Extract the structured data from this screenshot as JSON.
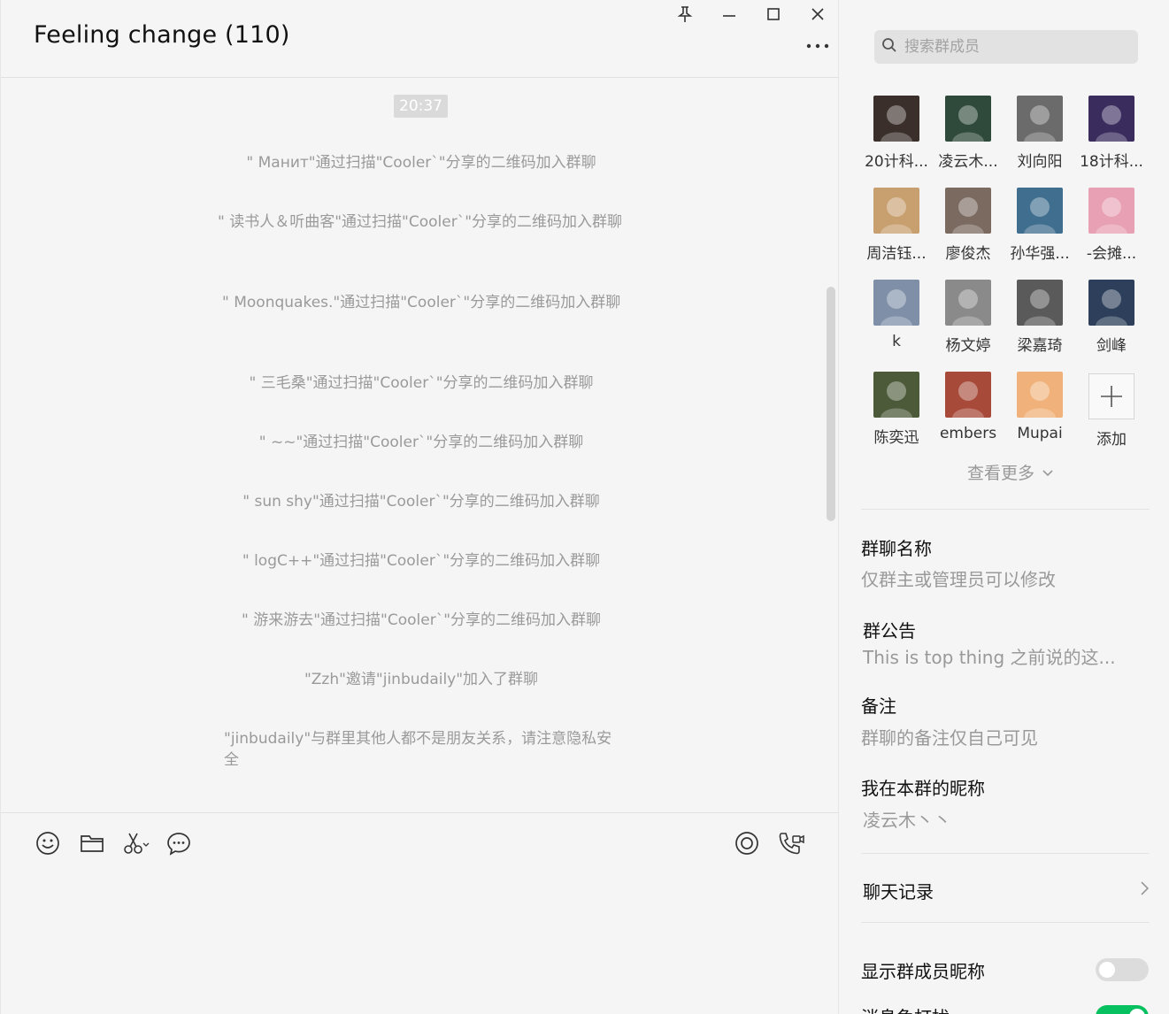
{
  "chat": {
    "title": "Feeling change (110)",
    "timestamp": "20:37",
    "messages": [
      " \" Манит\"通过扫描\"Cooler`\"分享的二维码加入群聊",
      "\" 读书人＆听曲客\"通过扫描\"Cooler`\"分享的二维码加入群聊",
      "\" Moonquakes.\"通过扫描\"Cooler`\"分享的二维码加入群聊",
      "\" 三毛桑\"通过扫描\"Cooler`\"分享的二维码加入群聊",
      "\" ~~\"通过扫描\"Cooler`\"分享的二维码加入群聊",
      "\" sun shy\"通过扫描\"Cooler`\"分享的二维码加入群聊",
      "\" logC++\"通过扫描\"Cooler`\"分享的二维码加入群聊",
      "\" 游来游去\"通过扫描\"Cooler`\"分享的二维码加入群聊",
      "\"Zzh\"邀请\"jinbudaily\"加入了群聊",
      "\"jinbudaily\"与群里其他人都不是朋友关系，请注意隐私安全"
    ]
  },
  "toolbar": {
    "icons": [
      "emoji-icon",
      "folder-icon",
      "scissors-icon",
      "chat-bubble-icon",
      "live-icon",
      "video-call-icon"
    ]
  },
  "side": {
    "search_placeholder": "搜索群成员",
    "members": [
      {
        "name": "20计科...",
        "color": "#3a2f2a"
      },
      {
        "name": "凌云木...",
        "color": "#2f4a3a"
      },
      {
        "name": "刘向阳",
        "color": "#6b6b6b"
      },
      {
        "name": "18计科...",
        "color": "#3b2c5e"
      },
      {
        "name": "周洁钰...",
        "color": "#c8a070"
      },
      {
        "name": "廖俊杰",
        "color": "#7a6a60"
      },
      {
        "name": "孙华强...",
        "color": "#3f6e8e"
      },
      {
        "name": "-会摊...",
        "color": "#e8a0b4"
      },
      {
        "name": "k",
        "color": "#7f8fa8"
      },
      {
        "name": "杨文婷",
        "color": "#8a8a8a"
      },
      {
        "name": "梁嘉琦",
        "color": "#5a5a5a"
      },
      {
        "name": "剑峰",
        "color": "#2d3f5a"
      },
      {
        "name": "陈奕迅",
        "color": "#4c5a3a"
      },
      {
        "name": "embers",
        "color": "#a84a3a"
      },
      {
        "name": "Mupai",
        "color": "#f0b27a"
      }
    ],
    "add_label": "添加",
    "see_more": "查看更多",
    "group_name_label": "群聊名称",
    "group_name_value": "仅群主或管理员可以修改",
    "notice_label": "群公告",
    "notice_value": "This is top thing  之前说的这...",
    "remark_label": "备注",
    "remark_value": "群聊的备注仅自己可见",
    "nickname_label": "我在本群的昵称",
    "nickname_value": "凌云木丶丶",
    "history_label": "聊天记录",
    "show_nick_label": "显示群成员昵称",
    "dnd_label": "消息免打扰",
    "show_nick_on": false,
    "dnd_on": true,
    "toggle_on_color": "#07c160",
    "toggle_off_color": "#dcdcdc"
  }
}
